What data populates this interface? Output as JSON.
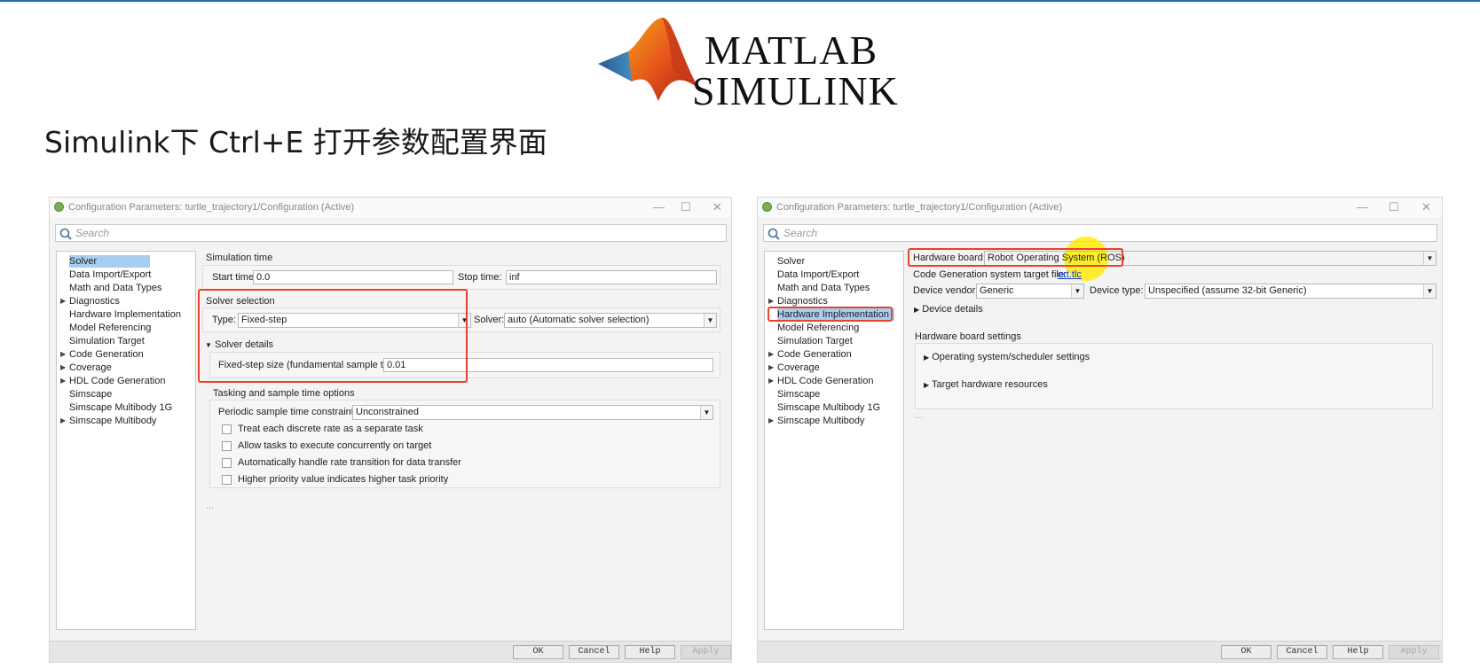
{
  "logo": {
    "line1": "MATLAB",
    "line2": "SIMULINK",
    "reg_mark": "®",
    "peak_icon": "matlab-membrane-logo"
  },
  "heading": "Simulink下 Ctrl+E 打开参数配置界面",
  "colors": {
    "accent_rule": "#1f6fb3",
    "highlight_box": "#e8412c",
    "tree_selection": "#a7cef0",
    "cursor_highlight": "#ffec00"
  },
  "window_controls": {
    "minimize": "—",
    "maximize": "☐",
    "close": "✕"
  },
  "left_dialog": {
    "title": "Configuration Parameters: turtle_trajectory1/Configuration (Active)",
    "search_placeholder": "Search",
    "tree": [
      {
        "label": "Solver",
        "selected": true,
        "expandable": false
      },
      {
        "label": "Data Import/Export",
        "expandable": false
      },
      {
        "label": "Math and Data Types",
        "expandable": false
      },
      {
        "label": "Diagnostics",
        "expandable": true
      },
      {
        "label": "Hardware Implementation",
        "expandable": false
      },
      {
        "label": "Model Referencing",
        "expandable": false
      },
      {
        "label": "Simulation Target",
        "expandable": false
      },
      {
        "label": "Code Generation",
        "expandable": true
      },
      {
        "label": "Coverage",
        "expandable": true
      },
      {
        "label": "HDL Code Generation",
        "expandable": true
      },
      {
        "label": "Simscape",
        "expandable": false
      },
      {
        "label": "Simscape Multibody 1G",
        "expandable": false
      },
      {
        "label": "Simscape Multibody",
        "expandable": true
      }
    ],
    "simulation_time": {
      "header": "Simulation time",
      "start_label": "Start time:",
      "start_value": "0.0",
      "stop_label": "Stop time:",
      "stop_value": "inf"
    },
    "solver_selection": {
      "header": "Solver selection",
      "type_label": "Type:",
      "type_value": "Fixed-step",
      "solver_label": "Solver:",
      "solver_value": "auto (Automatic solver selection)"
    },
    "solver_details": {
      "header": "Solver details",
      "fixed_step_label": "Fixed-step size (fundamental sample time):",
      "fixed_step_value": "0.01"
    },
    "tasking": {
      "header": "Tasking and sample time options",
      "constraint_label": "Periodic sample time constraint:",
      "constraint_value": "Unconstrained",
      "checkboxes": [
        "Treat each discrete rate as a separate task",
        "Allow tasks to execute concurrently on target",
        "Automatically handle rate transition for data transfer",
        "Higher priority value indicates higher task priority"
      ]
    },
    "more": "...",
    "buttons": {
      "ok": "OK",
      "cancel": "Cancel",
      "help": "Help",
      "apply": "Apply"
    }
  },
  "right_dialog": {
    "title": "Configuration Parameters: turtle_trajectory1/Configuration (Active)",
    "search_placeholder": "Search",
    "tree": [
      {
        "label": "Solver",
        "expandable": false
      },
      {
        "label": "Data Import/Export",
        "expandable": false
      },
      {
        "label": "Math and Data Types",
        "expandable": false
      },
      {
        "label": "Diagnostics",
        "expandable": true
      },
      {
        "label": "Hardware Implementation",
        "selected": true,
        "expandable": false
      },
      {
        "label": "Model Referencing",
        "expandable": false
      },
      {
        "label": "Simulation Target",
        "expandable": false
      },
      {
        "label": "Code Generation",
        "expandable": true
      },
      {
        "label": "Coverage",
        "expandable": true
      },
      {
        "label": "HDL Code Generation",
        "expandable": true
      },
      {
        "label": "Simscape",
        "expandable": false
      },
      {
        "label": "Simscape Multibody 1G",
        "expandable": false
      },
      {
        "label": "Simscape Multibody",
        "expandable": true
      }
    ],
    "hardware_board_label": "Hardware board:",
    "hardware_board_value": "Robot Operating System (ROS)",
    "target_file_label": "Code Generation system target file:",
    "target_file_value": "ert.tlc",
    "device_vendor_label": "Device vendor:",
    "device_vendor_value": "Generic",
    "device_type_label": "Device type:",
    "device_type_value": "Unspecified (assume 32-bit Generic)",
    "device_details": "Device details",
    "board_settings_header": "Hardware board settings",
    "board_settings_items": [
      "Operating system/scheduler settings",
      "Target hardware resources"
    ],
    "more": "...",
    "buttons": {
      "ok": "OK",
      "cancel": "Cancel",
      "help": "Help",
      "apply": "Apply"
    }
  }
}
